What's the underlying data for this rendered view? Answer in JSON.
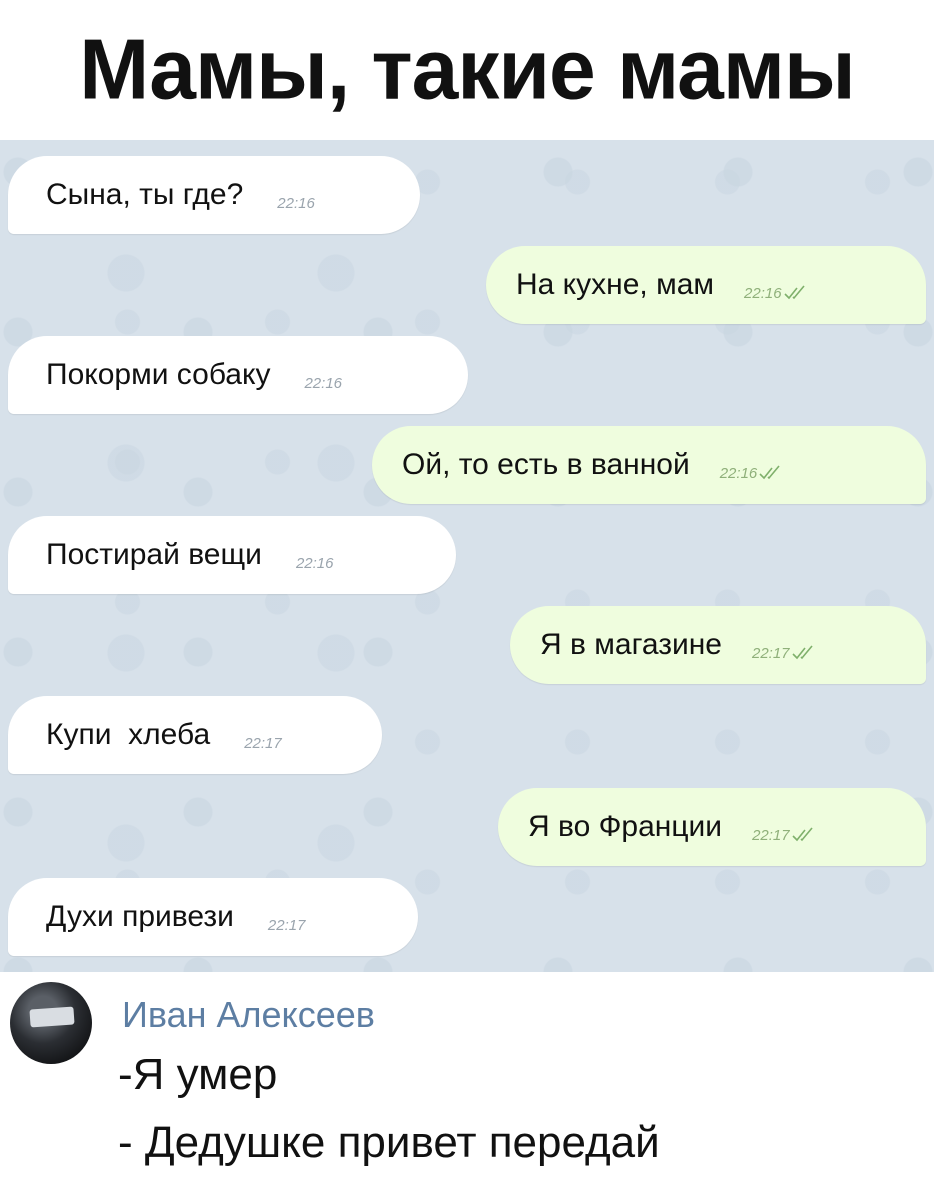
{
  "header": {
    "title": "Мамы, такие мамы"
  },
  "chat": {
    "messages": [
      {
        "direction": "in",
        "text": "Сына, ты где?",
        "time": "22:16"
      },
      {
        "direction": "out",
        "text": "На кухне, мам",
        "time": "22:16",
        "read": true
      },
      {
        "direction": "in",
        "text": "Покорми собаку",
        "time": "22:16"
      },
      {
        "direction": "out",
        "text": "Ой, то есть в ванной",
        "time": "22:16",
        "read": true
      },
      {
        "direction": "in",
        "text": "Постирай вещи",
        "time": "22:16"
      },
      {
        "direction": "out",
        "text": "Я в магазине",
        "time": "22:17",
        "read": true
      },
      {
        "direction": "in",
        "text": "Купи  хлеба",
        "time": "22:17"
      },
      {
        "direction": "out",
        "text": "Я во Франции",
        "time": "22:17",
        "read": true
      },
      {
        "direction": "in",
        "text": "Духи привези",
        "time": "22:17"
      }
    ],
    "colors": {
      "background": "#d7e1ea",
      "incoming": "#ffffff",
      "outgoing": "#effdde",
      "check": "#7fb06b"
    }
  },
  "comment": {
    "author": "Иван Алексеев",
    "lines": [
      "-Я умер",
      "- Дедушке привет передай"
    ],
    "author_color": "#5d7ea3"
  }
}
